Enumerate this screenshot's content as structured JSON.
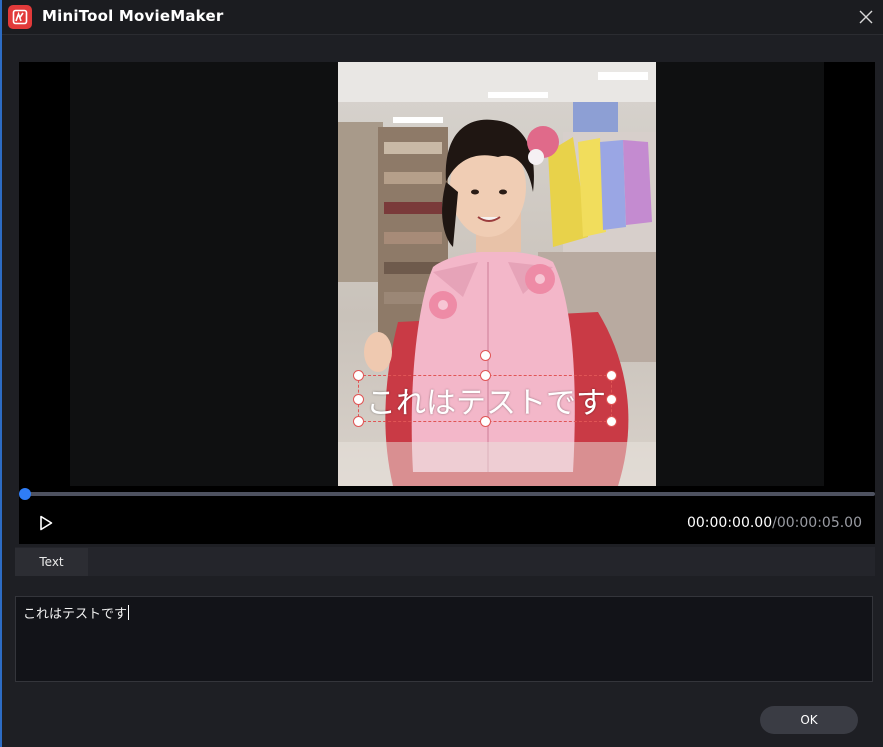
{
  "window": {
    "title": "MiniTool MovieMaker"
  },
  "preview": {
    "overlay_text": "これはテストです",
    "current_time": "00:00:00.00",
    "total_time": "00:00:05.00",
    "progress_fraction": 0
  },
  "tabs": [
    {
      "label": "Text",
      "active": true
    }
  ],
  "editor": {
    "value": "これはテストです"
  },
  "footer": {
    "ok_label": "OK"
  },
  "colors": {
    "accent": "#2f7df6",
    "logo": "#e23a3a",
    "selection": "#e05555",
    "background": "#1e1f24"
  },
  "icons": {
    "logo": "app-logo-icon",
    "close": "close-icon",
    "play": "play-icon"
  }
}
